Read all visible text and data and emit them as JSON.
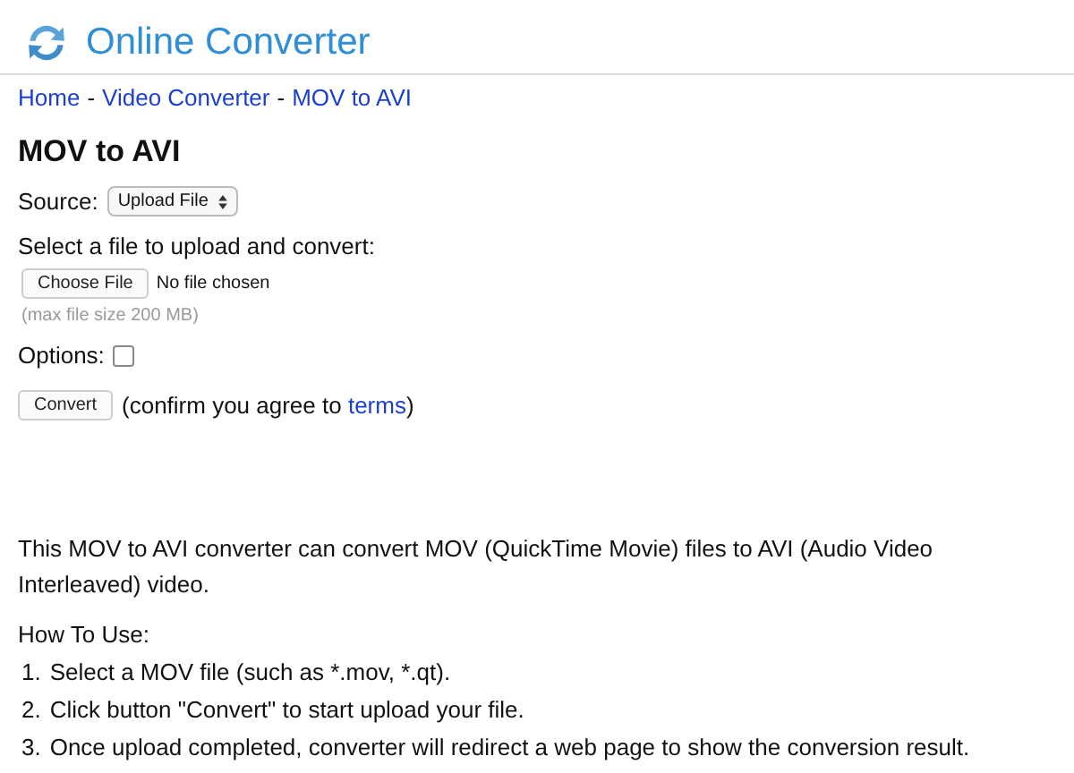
{
  "site": {
    "title": "Online Converter"
  },
  "breadcrumb": {
    "separator": "-",
    "items": [
      {
        "label": "Home"
      },
      {
        "label": "Video Converter"
      },
      {
        "label": "MOV to AVI"
      }
    ]
  },
  "heading": "MOV to AVI",
  "form": {
    "source_label": "Source:",
    "source_value": "Upload File",
    "file_label": "Select a file to upload and convert:",
    "file_button": "Choose File",
    "file_status": "No file chosen",
    "size_note": "(max file size 200 MB)",
    "options_label": "Options:",
    "options_checked": false,
    "convert_button": "Convert",
    "confirm_text": "(confirm you agree to",
    "terms_link": "terms",
    "confirm_end": ")"
  },
  "description": "This MOV to AVI converter can convert MOV (QuickTime Movie) files to AVI (Audio Video Interleaved) video.",
  "how_to": {
    "title": "How To Use:",
    "steps": [
      {
        "number": "1.",
        "text": "Select a MOV file (such as *.mov, *.qt)."
      },
      {
        "number": "2.",
        "text": "Click button \"Convert\" to start upload your file."
      },
      {
        "number": "3.",
        "text": "Once upload completed, converter will redirect a web page to show the conversion result."
      }
    ]
  }
}
